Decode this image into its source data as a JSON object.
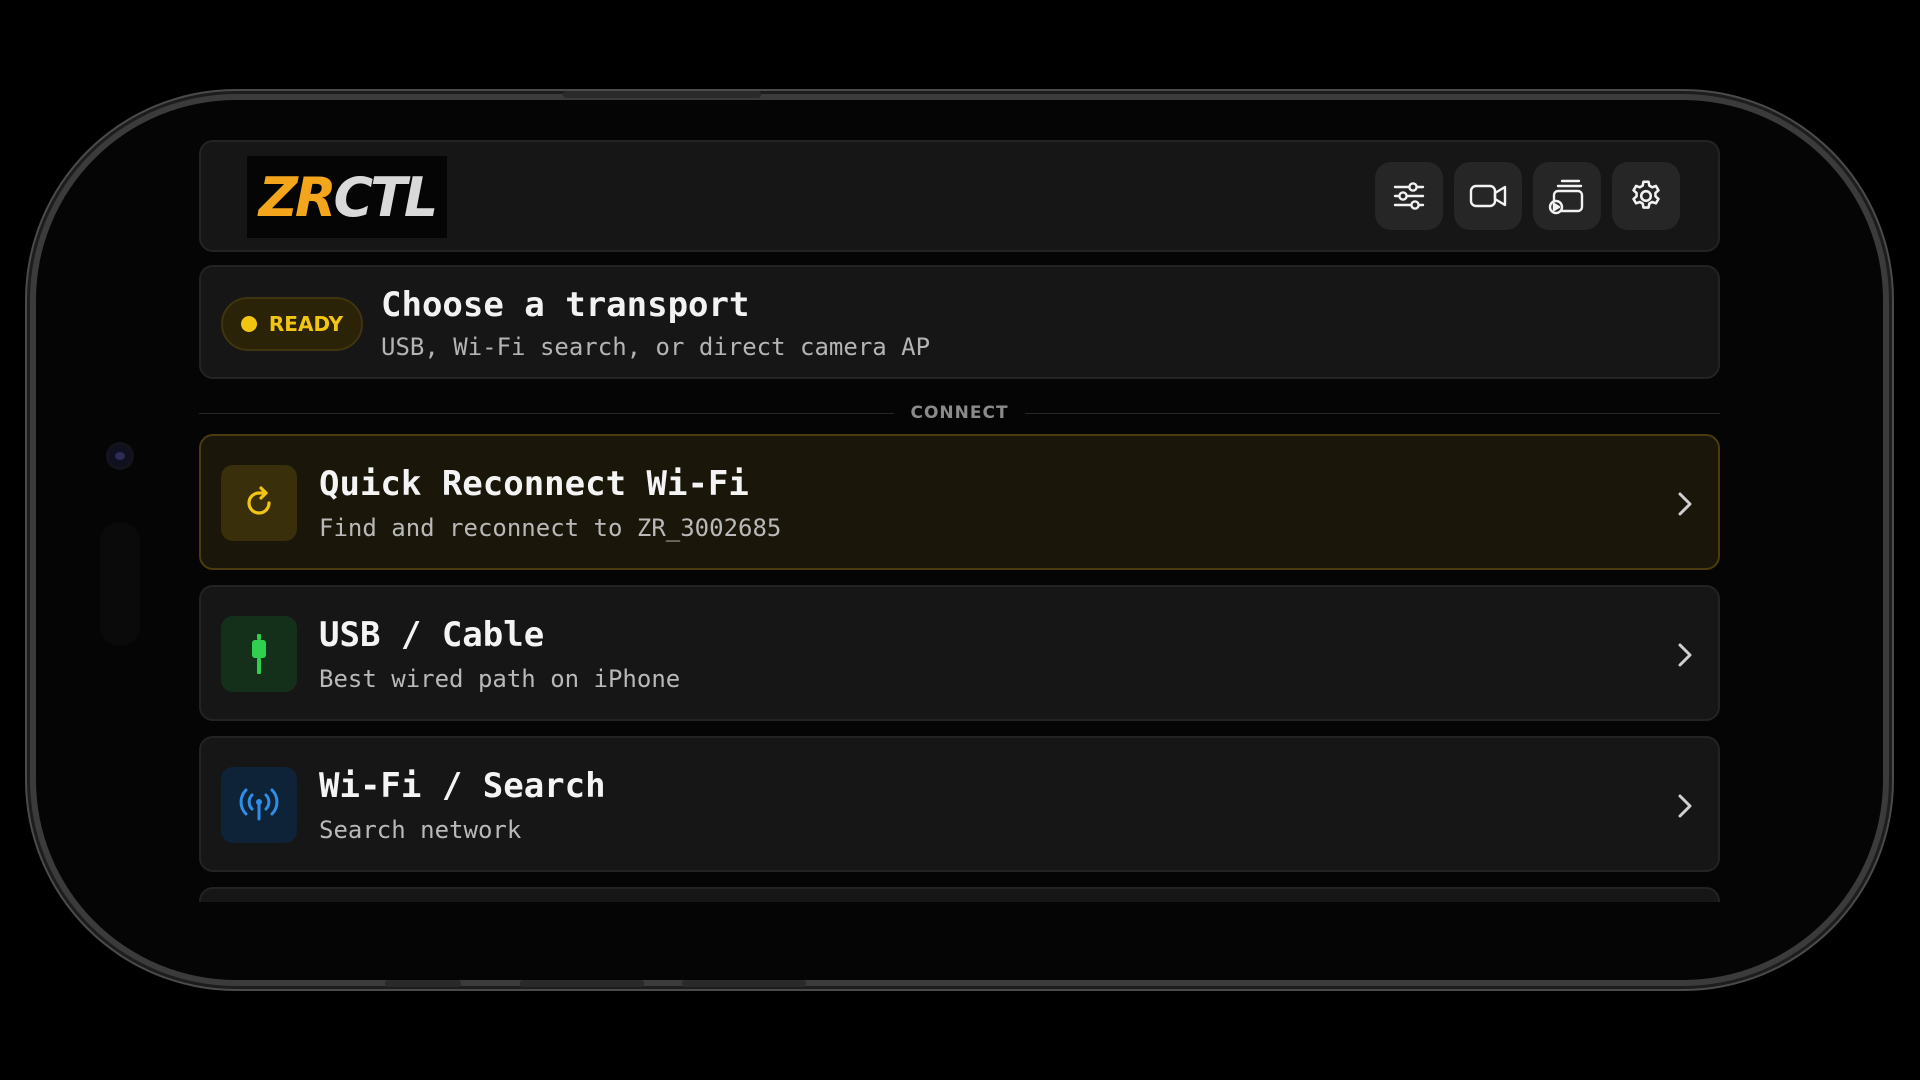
{
  "header": {
    "logo": {
      "part1": "ZR",
      "part2": "CTL"
    },
    "buttons": [
      {
        "name": "sliders-button",
        "icon": "sliders-icon"
      },
      {
        "name": "video-button",
        "icon": "video-camera-icon"
      },
      {
        "name": "media-button",
        "icon": "media-stack-icon"
      },
      {
        "name": "settings-button",
        "icon": "gear-icon"
      }
    ]
  },
  "status": {
    "badge": "READY",
    "badge_color": "#f2c513",
    "title": "Choose a transport",
    "subtitle": "USB, Wi-Fi search, or direct camera AP"
  },
  "section": {
    "label": "CONNECT"
  },
  "options": [
    {
      "title": "Quick Reconnect Wi-Fi",
      "subtitle": "Find and reconnect to ZR_3002685",
      "icon": "refresh-icon",
      "accent": "#f2c513"
    },
    {
      "title": "USB / Cable",
      "subtitle": "Best wired path on iPhone",
      "icon": "usb-plug-icon",
      "accent": "#2fcf4f"
    },
    {
      "title": "Wi-Fi / Search",
      "subtitle": "Search network",
      "icon": "antenna-icon",
      "accent": "#2f8fe8"
    }
  ]
}
